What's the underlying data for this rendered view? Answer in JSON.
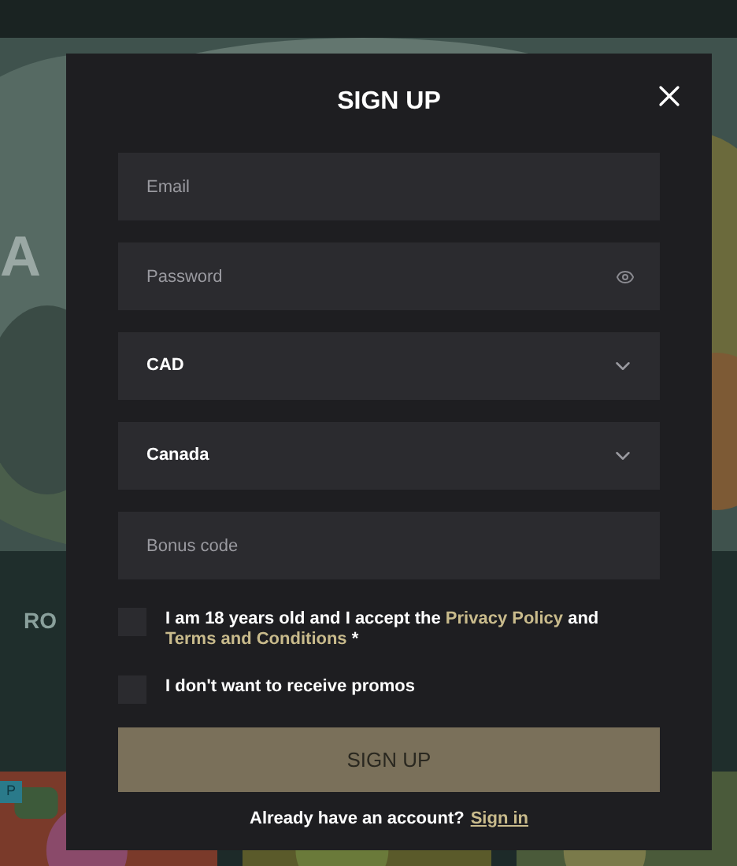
{
  "background": {
    "hero_text": "A",
    "section_title": "RO",
    "tile_badge": "P"
  },
  "modal": {
    "title": "SIGN UP",
    "fields": [
      {
        "kind": "text",
        "placeholder": "Email"
      },
      {
        "kind": "password",
        "placeholder": "Password"
      },
      {
        "kind": "select",
        "value": "CAD"
      },
      {
        "kind": "select",
        "value": "Canada"
      },
      {
        "kind": "text",
        "placeholder": "Bonus code"
      }
    ],
    "checkboxes": [
      {
        "checked": false,
        "parts": [
          {
            "kind": "text",
            "text": "I am 18 years old and I accept the "
          },
          {
            "kind": "link",
            "text": "Privacy Policy"
          },
          {
            "kind": "text",
            "text": " and "
          },
          {
            "kind": "link",
            "text": "Terms and Conditions"
          },
          {
            "kind": "text",
            "text": " *"
          }
        ]
      },
      {
        "checked": false,
        "parts": [
          {
            "kind": "text",
            "text": "I don't want to receive promos"
          }
        ]
      }
    ],
    "submit": {
      "label": "SIGN UP",
      "disabled": true
    },
    "footer": {
      "text": "Already have an account?",
      "link": "Sign in"
    }
  }
}
